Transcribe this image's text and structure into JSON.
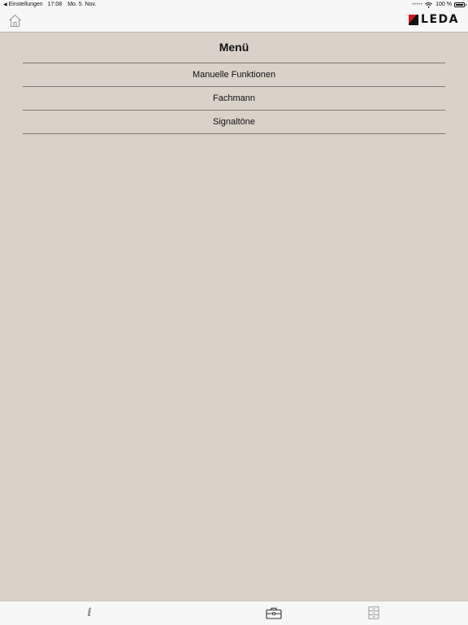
{
  "status_bar": {
    "back_label": "Einstellungen",
    "time": "17:08",
    "date": "Mo. 5. Nov.",
    "battery": "100 %",
    "battery_level": 1.0
  },
  "nav": {
    "home_icon": "home-icon",
    "logo_text": "LEDA",
    "logo_colors": [
      "#d7141a",
      "#111111"
    ]
  },
  "menu": {
    "title": "Menü",
    "items": [
      {
        "label": "Manuelle Funktionen"
      },
      {
        "label": "Fachmann"
      },
      {
        "label": "Signaltöne"
      }
    ]
  },
  "tab_bar": {
    "info_glyph": "i",
    "tabs": [
      {
        "icon": "info-icon",
        "active": false
      },
      {
        "icon": "briefcase-icon",
        "active": true
      },
      {
        "icon": "archive-drawer-icon",
        "active": false
      }
    ]
  },
  "colors": {
    "background": "#dad1c8",
    "bar_background": "#f7f7f7",
    "divider": "#7e7a75",
    "accent": "#d7141a"
  }
}
